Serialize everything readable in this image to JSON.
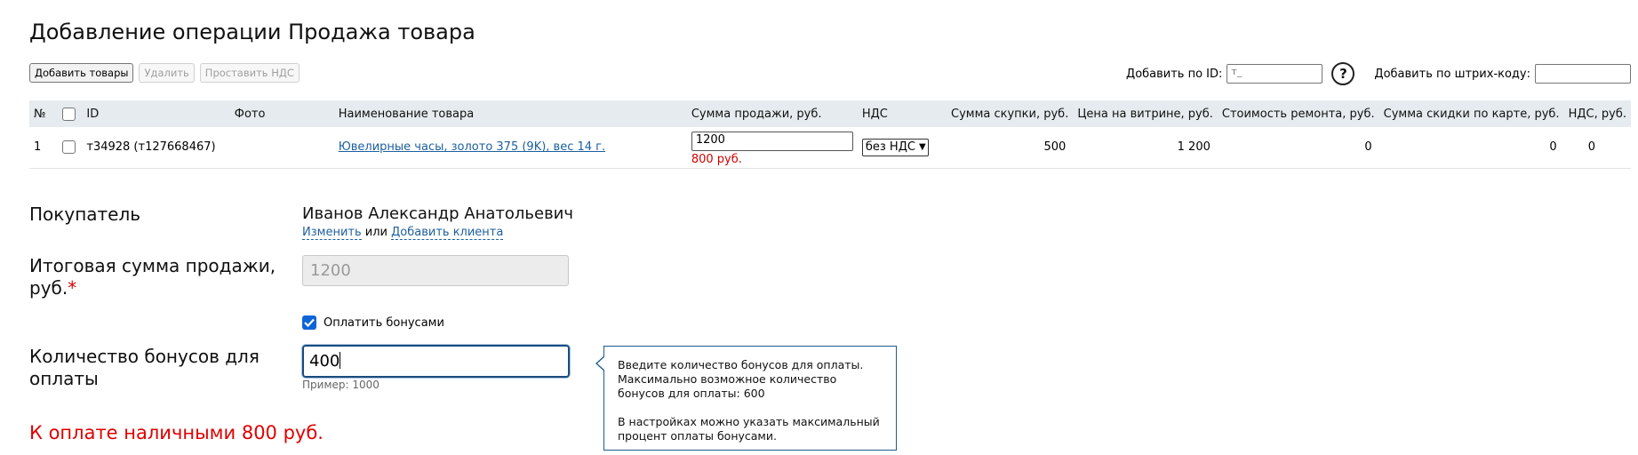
{
  "page": {
    "title": "Добавление операции Продажа товара"
  },
  "toolbar": {
    "add_goods": "Добавить товары",
    "delete": "Удалить",
    "set_vat": "Проставить НДС",
    "add_by_id_label": "Добавить по ID:",
    "id_value": "т_",
    "help": "?",
    "add_by_barcode_label": "Добавить по штрих-коду:",
    "barcode_value": ""
  },
  "table": {
    "headers": {
      "num": "№",
      "id": "ID",
      "photo": "Фото",
      "name": "Наименование товара",
      "sale_sum": "Сумма продажи, руб.",
      "vat": "НДС",
      "purchase_sum": "Сумма скупки, руб.",
      "showcase_price": "Цена на витрине, руб.",
      "repair_cost": "Стоимость ремонта, руб.",
      "card_discount": "Сумма скидки по карте, руб.",
      "vat_rub": "НДС, руб."
    },
    "rows": [
      {
        "num": "1",
        "id": "т34928 (т127668467)",
        "photo": "",
        "name": "Ювелирные часы, золото 375 (9K), вес 14 г.",
        "sale_sum": "1200",
        "sale_note": "800 руб.",
        "vat": "без НДС",
        "purchase_sum": "500",
        "showcase_price": "1 200",
        "repair_cost": "0",
        "card_discount": "0",
        "vat_rub": "0"
      }
    ]
  },
  "form": {
    "buyer_label": "Покупатель",
    "buyer_name": "Иванов Александр Анатольевич",
    "change_link": "Изменить",
    "or_text": "или",
    "add_client_link": "Добавить клиента",
    "total_label": "Итоговая сумма продажи, руб.",
    "required_mark": "*",
    "total_value": "1200",
    "pay_bonus_label": "Оплатить бонусами",
    "bonus_label": "Количество бонусов для оплаты",
    "bonus_value": "400",
    "example": "Пример: 1000",
    "pay_cash": "К оплате наличными 800 руб."
  },
  "tooltip": {
    "line1": "Введите количество бонусов для оплаты. Максимально возможное количество бонусов для оплаты: 600",
    "line2": "В настройках можно указать максимальный процент оплаты бонусами."
  },
  "colors": {
    "link": "#1c5f9e",
    "alert": "#e00000",
    "header_bg": "#e5ebee",
    "focus": "#1a4d80"
  }
}
